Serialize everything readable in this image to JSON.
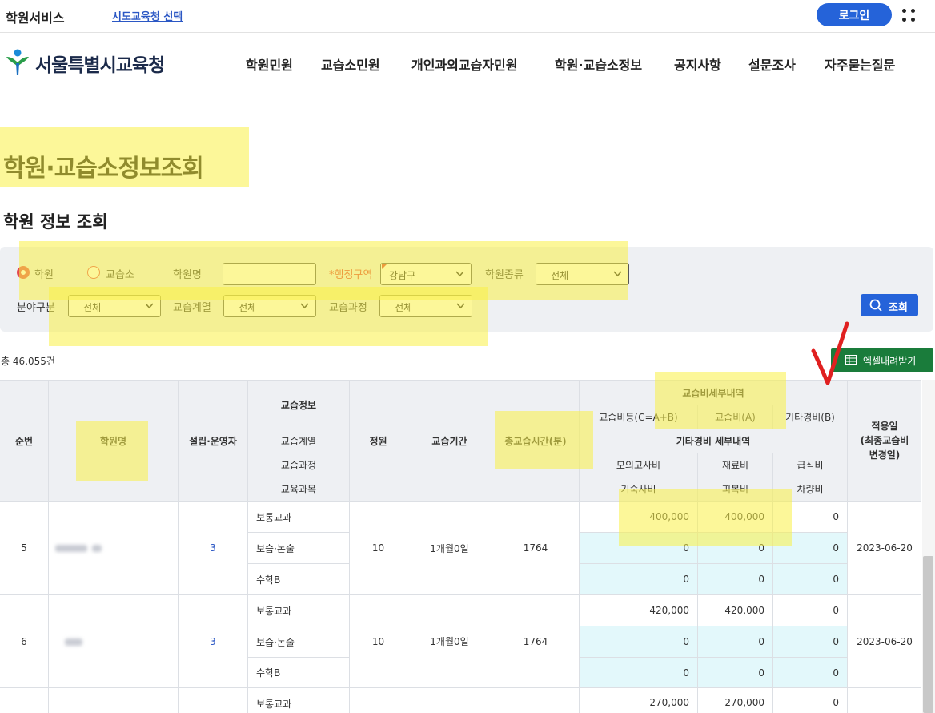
{
  "topbar": {
    "service_name": "학원서비스",
    "office_select": "시도교육청 선택",
    "login_label": "로그인"
  },
  "header": {
    "logo_text": "서울특별시교육청",
    "nav": [
      "학원민원",
      "교습소민원",
      "개인과외교습자민원",
      "학원·교습소정보",
      "공지사항",
      "설문조사",
      "자주묻는질문"
    ]
  },
  "page_title": "학원·교습소정보조회",
  "section_title": "학원 정보 조회",
  "search": {
    "type_academy": "학원",
    "type_tutoring": "교습소",
    "name_label": "학원명",
    "name_value": "",
    "district_label": "*행정구역",
    "district_value": "강남구",
    "kind_label": "학원종류",
    "kind_value": "- 전체 -",
    "field_label": "분야구분",
    "field_value": "- 전체 -",
    "series_label": "교습계열",
    "series_value": "- 전체 -",
    "course_label": "교습과정",
    "course_value": "- 전체 -",
    "submit_label": "조회"
  },
  "total_label": "총 46,055건",
  "excel_label": "엑셀내려받기",
  "table": {
    "headers": {
      "no": "순번",
      "name": "학원명",
      "founder": "설립·운영자",
      "teach_info": "교습정보",
      "teach_series": "교습계열",
      "teach_course": "교습과정",
      "teach_subject": "교육과목",
      "capacity": "정원",
      "period": "교습기간",
      "total_time": "총교습시간(분)",
      "fee_detail": "교습비세부내역",
      "fee_total": "교습비등(C=A+B)",
      "fee_a": "교습비(A)",
      "fee_b": "기타경비(B)",
      "other_detail": "기타경비 세부내역",
      "mock_exam": "모의고사비",
      "material": "재료비",
      "meal": "급식비",
      "dorm": "기숙사비",
      "uniform": "피복비",
      "vehicle": "차량비",
      "apply_date": "적용일",
      "apply_date_sub": "(최종교습비",
      "apply_date_sub2": "변경일)"
    },
    "rows": [
      {
        "no": "5",
        "founder": "3",
        "capacity": "10",
        "period": "1개월0일",
        "total_time": "1764",
        "apply_date": "2023-06-20",
        "subjects": [
          {
            "subject": "보통교과",
            "fee_total": "400,000",
            "fee_a": "400,000",
            "fee_b": "0"
          },
          {
            "subject": "보습·논술",
            "fee_total": "0",
            "fee_a": "0",
            "fee_b": "0"
          },
          {
            "subject": "수학B",
            "fee_total": "0",
            "fee_a": "0",
            "fee_b": "0"
          }
        ]
      },
      {
        "no": "6",
        "founder": "3",
        "capacity": "10",
        "period": "1개월0일",
        "total_time": "1764",
        "apply_date": "2023-06-20",
        "subjects": [
          {
            "subject": "보통교과",
            "fee_total": "420,000",
            "fee_a": "420,000",
            "fee_b": "0"
          },
          {
            "subject": "보습·논술",
            "fee_total": "0",
            "fee_a": "0",
            "fee_b": "0"
          },
          {
            "subject": "수학B",
            "fee_total": "0",
            "fee_a": "0",
            "fee_b": "0"
          }
        ]
      },
      {
        "subjects": [
          {
            "subject": "보통교과",
            "fee_total": "270,000",
            "fee_a": "270,000",
            "fee_b": "0"
          }
        ]
      }
    ]
  },
  "colors": {
    "accent_blue": "#2563d9",
    "excel_green": "#1a7c3b",
    "radio_red": "#e3484e",
    "highlight": "#faf046",
    "cyan_cell": "#e3f8fb"
  }
}
